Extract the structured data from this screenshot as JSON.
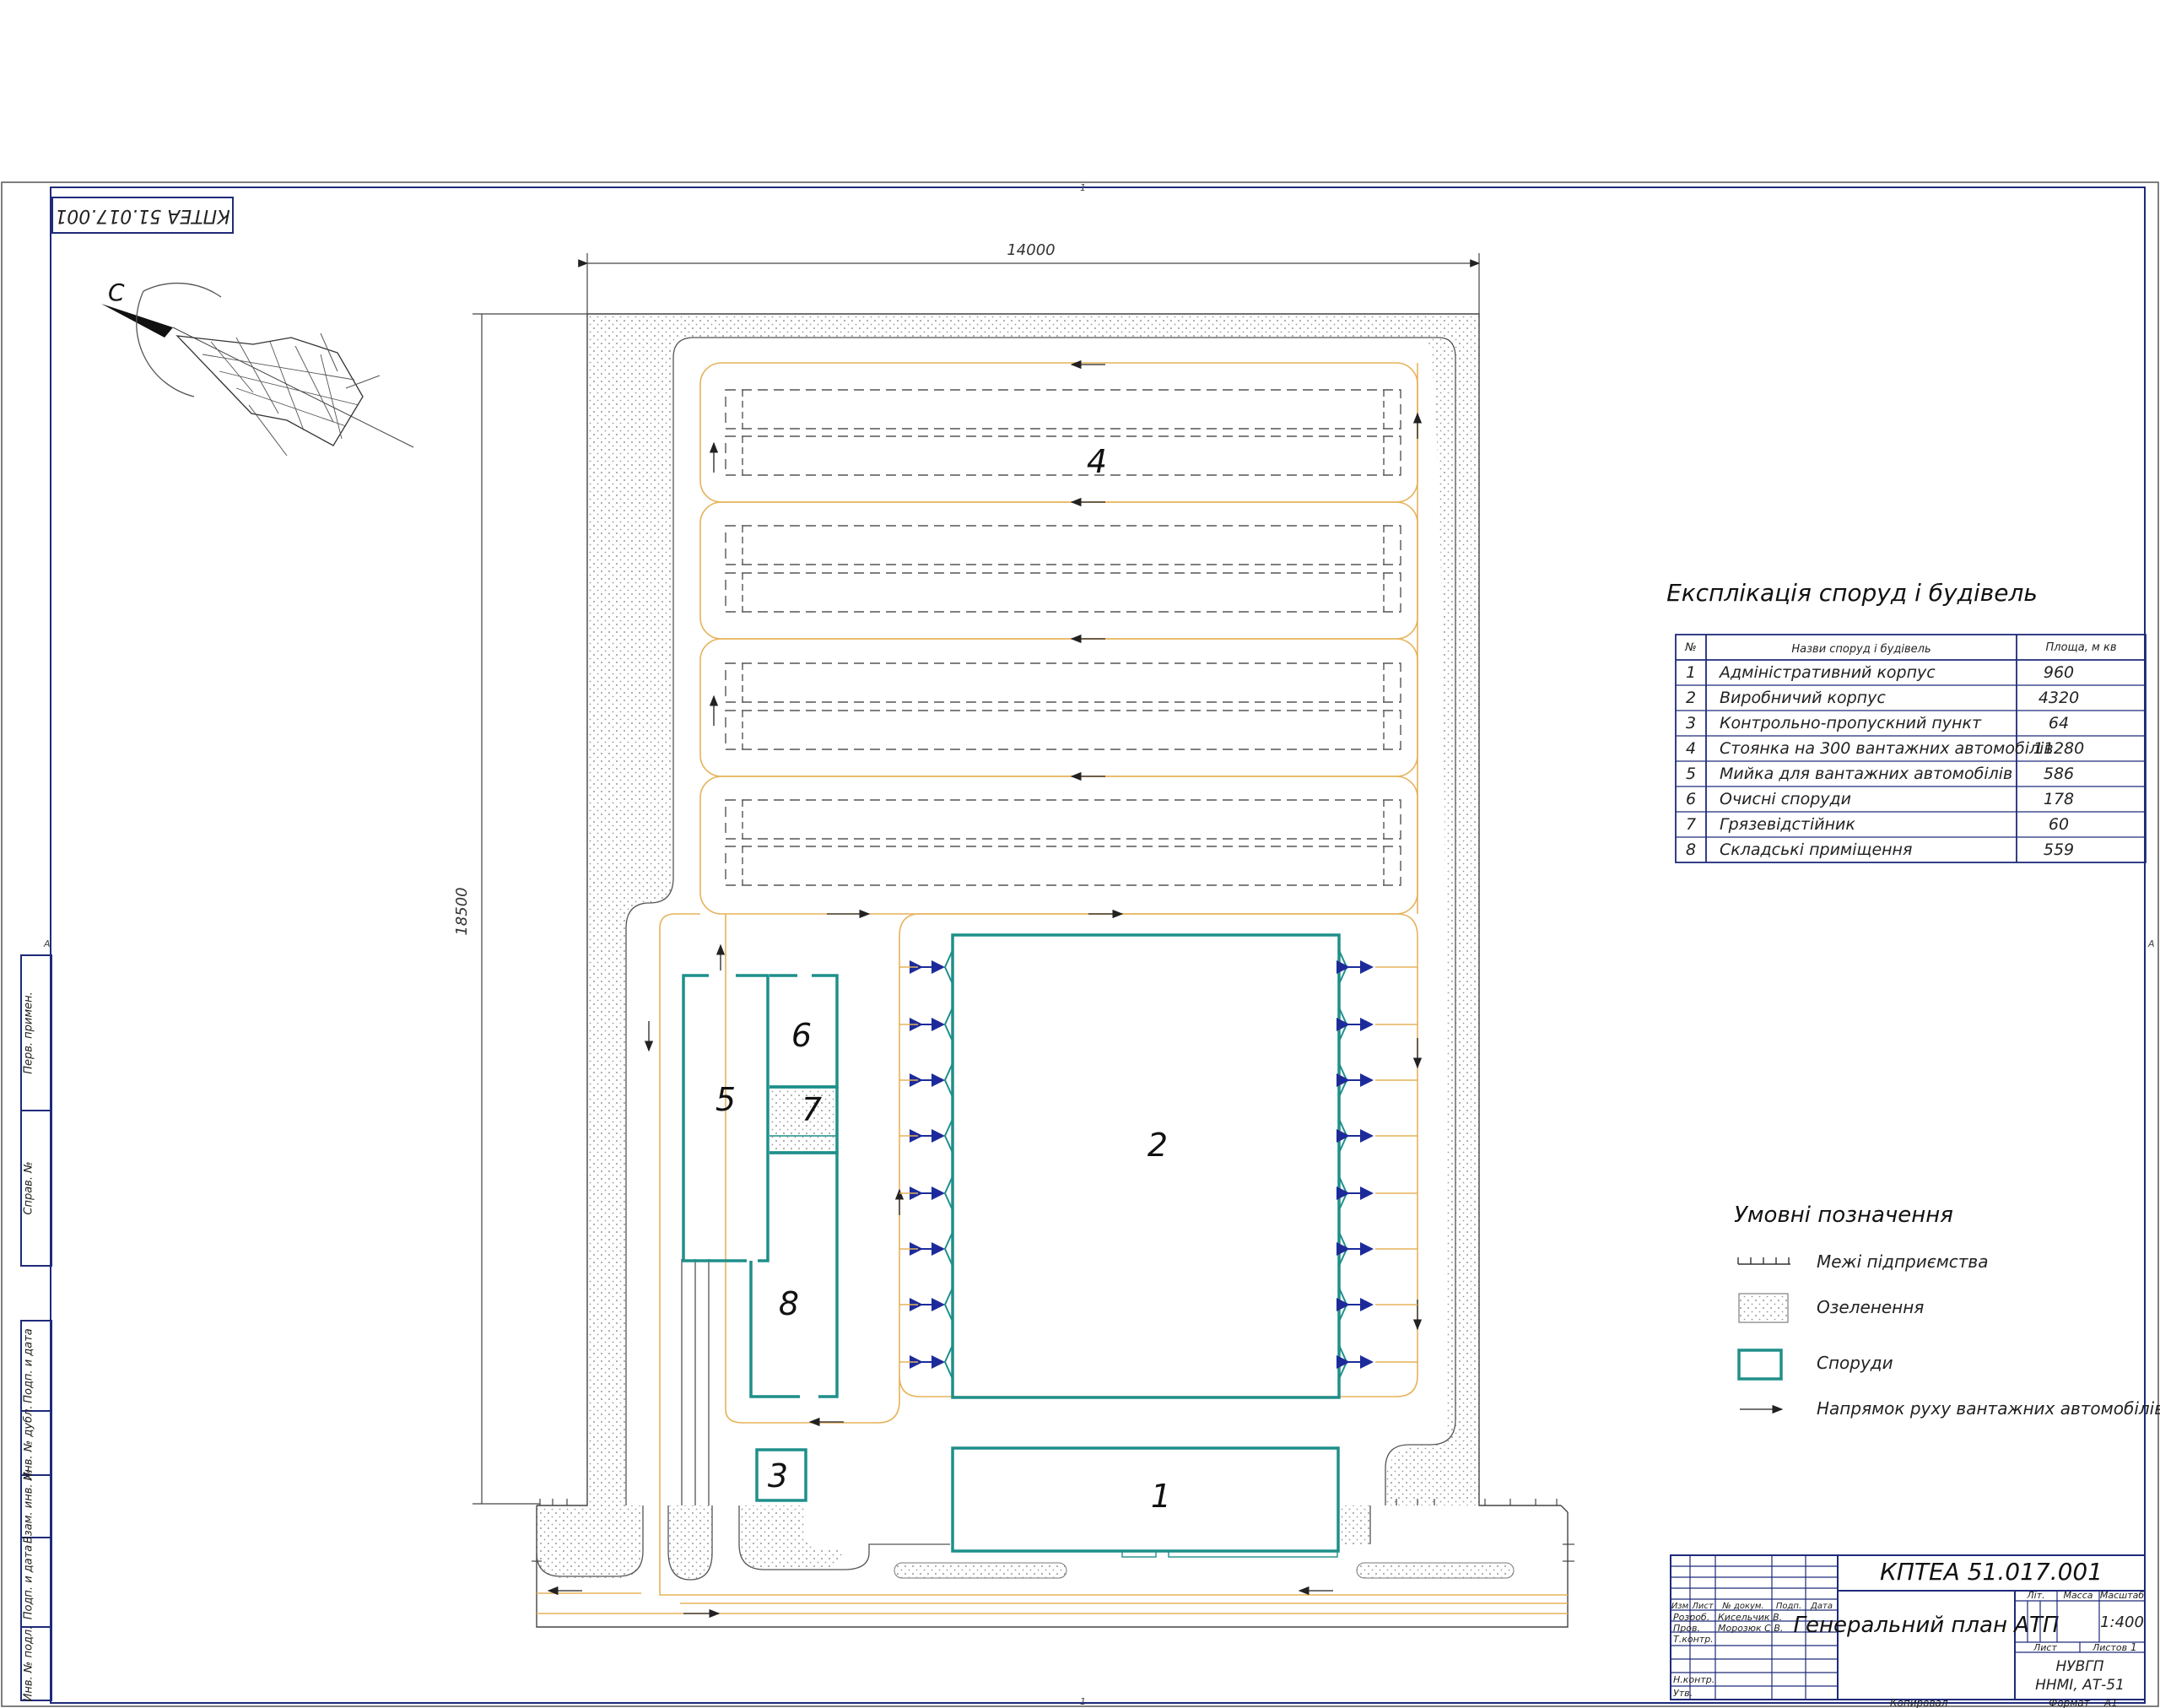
{
  "sheet": {
    "code_main": "КПТЕА 51.017.001",
    "code_stamp_rotated": "КПТЕА 51.017.001",
    "title": "Генеральний план АТП",
    "sheet_mark_top": "1",
    "sheet_mark_bottom": "1",
    "sheet_mark_left": "А",
    "sheet_mark_right": "А"
  },
  "plan": {
    "dim_width": "14000",
    "dim_height": "18500",
    "north_label": "С",
    "building_numbers": [
      "1",
      "2",
      "3",
      "4",
      "5",
      "6",
      "7",
      "8"
    ]
  },
  "explication": {
    "title": "Експлікація споруд і будівель",
    "headers": [
      "№",
      "Назви споруд і будівель",
      "Площа, м кв"
    ],
    "rows": [
      {
        "n": "1",
        "name": "Адміністративний корпус",
        "area": "960"
      },
      {
        "n": "2",
        "name": "Виробничий корпус",
        "area": "4320"
      },
      {
        "n": "3",
        "name": "Контрольно-пропускний пункт",
        "area": "64"
      },
      {
        "n": "4",
        "name": "Стоянка на 300 вантажних автомобілів",
        "area": "11280"
      },
      {
        "n": "5",
        "name": "Мийка для вантажних автомобілів",
        "area": "586"
      },
      {
        "n": "6",
        "name": "Очисні споруди",
        "area": "178"
      },
      {
        "n": "7",
        "name": "Грязевідстійник",
        "area": "60"
      },
      {
        "n": "8",
        "name": "Складські приміщення",
        "area": "559"
      }
    ]
  },
  "legend": {
    "title": "Умовні позначення",
    "items": [
      {
        "key": "boundary",
        "label": "Межі підприємства"
      },
      {
        "key": "greenery",
        "label": "Озеленення"
      },
      {
        "key": "buildings",
        "label": "Споруди"
      },
      {
        "key": "traffic",
        "label": "Напрямок руху вантажних автомобілів"
      }
    ]
  },
  "titleblock": {
    "code": "КПТЕА 51.017.001",
    "title": "Генеральний план АТП",
    "col_headers": [
      "Изм",
      "Лист",
      "№ докум.",
      "Подп.",
      "Дата"
    ],
    "roles": [
      {
        "role": "Розроб.",
        "name": "Кисельчик В."
      },
      {
        "role": "Пров.",
        "name": "Морозюк С.В."
      },
      {
        "role": "Т.контр.",
        "name": ""
      },
      {
        "role": "Н.контр.",
        "name": ""
      },
      {
        "role": "Утв.",
        "name": ""
      }
    ],
    "lit_label": "Літ.",
    "mass_label": "Масса",
    "scale_label": "Масштаб",
    "scale": "1:400",
    "sheet_label": "Лист",
    "sheets_label": "Листов",
    "sheets_total": "1",
    "org_line1": "НУВГП",
    "org_line2": "ННМІ, АТ-51",
    "copied": "Копировал",
    "format_label": "Формат",
    "format": "А1"
  },
  "side_columns": [
    "Перв. примен.",
    "Справ. №",
    "Подп. и дата",
    "Инв. № дубл.",
    "Взам. инв. №",
    "Подп. и дата",
    "Инв. № подл."
  ],
  "colors": {
    "frame": "#1f2a7a",
    "building": "#1f8f8a",
    "road": "#e6b25a",
    "arrow": "#1d2b9a",
    "line": "#444444"
  }
}
